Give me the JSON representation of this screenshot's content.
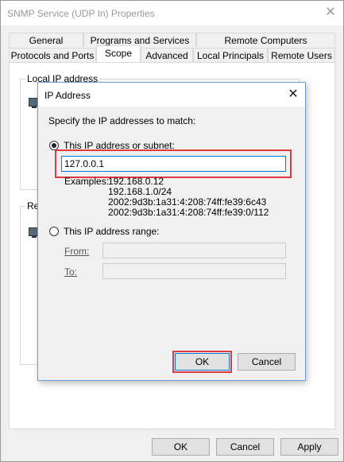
{
  "parent": {
    "title": "SNMP Service (UDP In) Properties",
    "tabs_row1": [
      "General",
      "Programs and Services",
      "Remote Computers"
    ],
    "tabs_row2": [
      "Protocols and Ports",
      "Scope",
      "Advanced",
      "Local Principals",
      "Remote Users"
    ],
    "active_tab": "Scope",
    "local_group_label": "Local IP address",
    "remote_group_label_partial": "Re",
    "buttons": {
      "ok": "OK",
      "cancel": "Cancel",
      "apply": "Apply"
    }
  },
  "dialog": {
    "title": "IP Address",
    "instruction": "Specify the IP addresses to match:",
    "option_subnet": "This IP address or subnet:",
    "ip_value": "127.0.0.1",
    "examples_label": "Examples:",
    "examples": [
      "192.168.0.12",
      "192.168.1.0/24",
      "2002:9d3b:1a31:4:208:74ff:fe39:6c43",
      "2002:9d3b:1a31:4:208:74ff:fe39:0/112"
    ],
    "option_range": "This IP address range:",
    "from_label": "From:",
    "to_label": "To:",
    "ok": "OK",
    "cancel": "Cancel",
    "selected_option": "subnet"
  },
  "colors": {
    "highlight": "#e0393e",
    "dialog_border": "#6d9bd4",
    "focus_blue": "#0078d7"
  },
  "icons": [
    "close-icon",
    "computer-icon"
  ]
}
